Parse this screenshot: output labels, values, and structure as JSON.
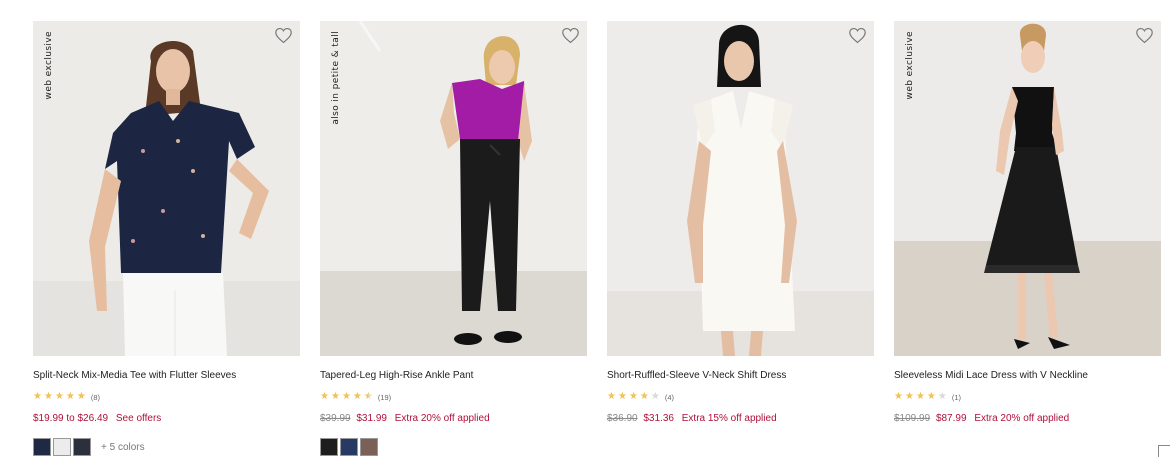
{
  "products": [
    {
      "badge": "web exclusive",
      "name": "Split-Neck Mix-Media Tee with Flutter Sleeves",
      "rating": 5,
      "review_count": "(8)",
      "price_original": "",
      "price_range_low": "$19.99",
      "price_range_sep": "to",
      "price_range_high": "$26.49",
      "promo": "See offers",
      "swatches": [
        "#1f2944",
        "#ececec",
        "#2c2f3c"
      ],
      "more_colors": "+ 5 colors"
    },
    {
      "badge": "also in petite & tall",
      "name": "Tapered-Leg High-Rise Ankle Pant",
      "rating": 4.5,
      "review_count": "(19)",
      "price_original": "$39.99",
      "price_sale": "$31.99",
      "promo": "Extra 20% off applied",
      "swatches": [
        "#1d1d1d",
        "#263a63",
        "#7b6058"
      ],
      "more_colors": ""
    },
    {
      "badge": "",
      "name": "Short-Ruffled-Sleeve V-Neck Shift Dress",
      "rating": 4,
      "review_count": "(4)",
      "price_original": "$36.90",
      "price_sale": "$31.36",
      "promo": "Extra 15% off applied",
      "swatches": [],
      "more_colors": ""
    },
    {
      "badge": "web exclusive",
      "name": "Sleeveless Midi Lace Dress with V Neckline",
      "rating": 4,
      "review_count": "(1)",
      "price_original": "$109.99",
      "price_sale": "$87.99",
      "promo": "Extra 20% off applied",
      "swatches": [],
      "more_colors": ""
    }
  ],
  "colors": {
    "sale": "#b0103a",
    "star": "#f2c14e",
    "strike": "#8a8a8a"
  },
  "icons": {
    "wishlist": "heart-outline-icon",
    "rating": "star-icon"
  }
}
